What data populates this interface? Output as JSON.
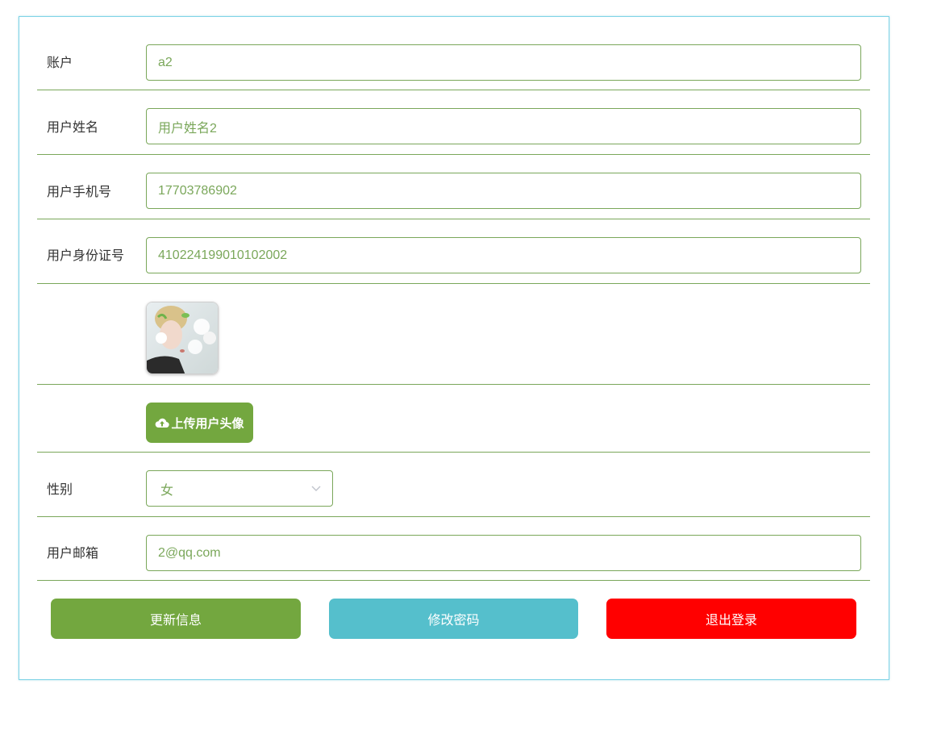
{
  "form": {
    "account": {
      "label": "账户",
      "value": "a2"
    },
    "name": {
      "label": "用户姓名",
      "value": "用户姓名2"
    },
    "phone": {
      "label": "用户手机号",
      "value": "17703786902"
    },
    "id_card": {
      "label": "用户身份证号",
      "value": "410224199010102002"
    },
    "upload_label": "上传用户头像",
    "gender": {
      "label": "性别",
      "value": "女"
    },
    "email": {
      "label": "用户邮箱",
      "value": "2@qq.com"
    }
  },
  "actions": {
    "update_label": "更新信息",
    "change_password_label": "修改密码",
    "logout_label": "退出登录"
  },
  "colors": {
    "primary": "#73a73f",
    "info": "#55bfcc",
    "danger": "#ff0000",
    "border": "#7aa75a"
  },
  "icons": {
    "upload": "cloud-upload-icon",
    "select_arrow": "chevron-down-icon"
  }
}
